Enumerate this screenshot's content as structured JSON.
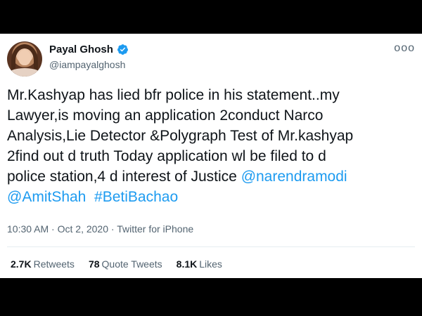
{
  "author": {
    "display_name": "Payal Ghosh",
    "handle": "@iampayalghosh",
    "verified_icon": "verified-badge-icon",
    "more_icon": "more-options-icon",
    "more_glyph": "ooo"
  },
  "tweet": {
    "text_lines": [
      "Mr.Kashyap has lied bfr police in his statement..my",
      "Lawyer,is moving an application 2conduct Narco",
      "Analysis,Lie Detector &Polygraph Test of Mr.kashyap",
      "2find out d truth Today application wl be filed to d",
      "police station,4 d interest of Justice "
    ],
    "mention_narendramodi": "@narendramodi",
    "mention_amitshah": "@AmitShah",
    "hashtag": "#BetiBachao"
  },
  "meta": {
    "time": "10:30 AM",
    "date": "Oct 2, 2020",
    "separator": " · ",
    "source": "Twitter for iPhone"
  },
  "stats": {
    "retweets_count": "2.7K",
    "retweets_label": "Retweets",
    "quotes_count": "78",
    "quotes_label": "Quote Tweets",
    "likes_count": "8.1K",
    "likes_label": "Likes"
  },
  "colors": {
    "link": "#1d9bf0",
    "verified": "#1d9bf0",
    "text": "#0f1419",
    "secondary": "#536471",
    "letterbox": "#000000"
  }
}
